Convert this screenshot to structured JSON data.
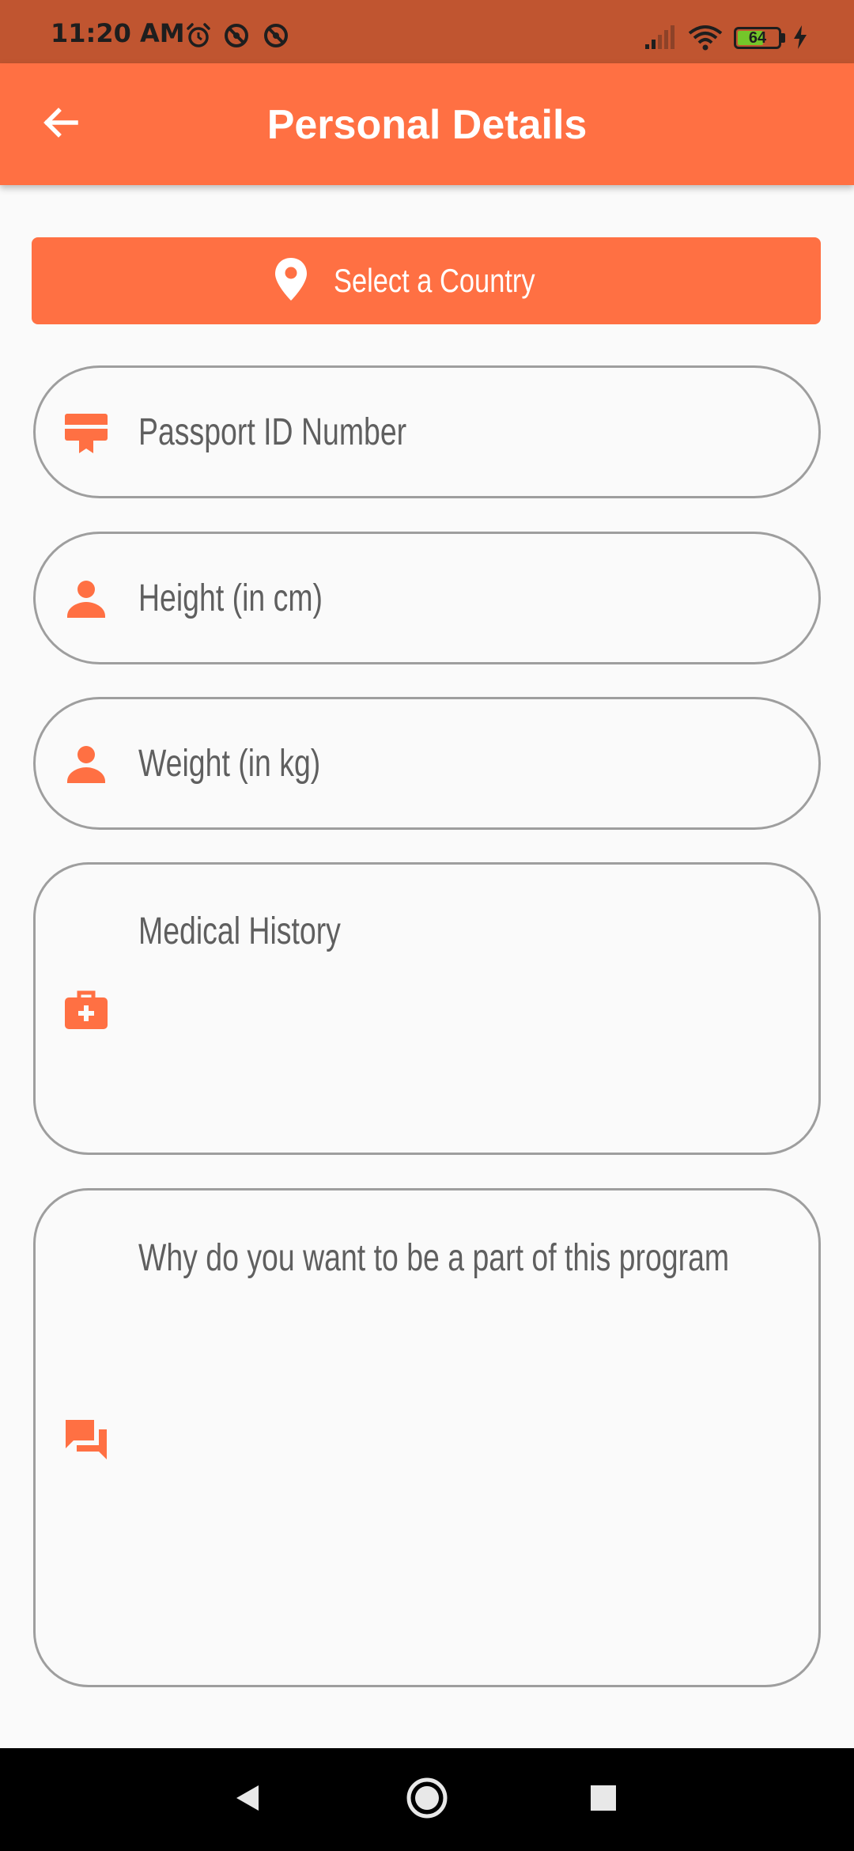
{
  "status_bar": {
    "time": "11:20 AM",
    "battery_level": 64,
    "battery_label": "64",
    "icons": [
      "alarm-icon",
      "do-not-disturb-icon",
      "do-not-disturb-icon",
      "signal-icon",
      "wifi-icon",
      "battery-icon",
      "charging-icon"
    ]
  },
  "app_bar": {
    "title": "Personal Details",
    "back_icon": "arrow-left-icon"
  },
  "country_button": {
    "label": "Select a Country",
    "icon": "location-pin-icon"
  },
  "fields": {
    "passport": {
      "placeholder": "Passport ID Number",
      "icon": "id-card-icon"
    },
    "height": {
      "placeholder": "Height (in cm)",
      "icon": "person-icon"
    },
    "weight": {
      "placeholder": "Weight (in kg)",
      "icon": "person-icon"
    },
    "medical_history": {
      "placeholder": "Medical History",
      "icon": "medical-kit-icon"
    },
    "motivation": {
      "placeholder": "Why do you want to be a part of this program",
      "icon": "chat-bubbles-icon"
    }
  },
  "nav_bar": {
    "buttons": [
      "back-triangle-icon",
      "home-circle-icon",
      "recents-square-icon"
    ]
  },
  "colors": {
    "accent": "#ff7043",
    "status_bar": "#c05530",
    "field_border": "#9e9e9e",
    "placeholder": "#5f5f5f",
    "background": "#fafafa"
  }
}
